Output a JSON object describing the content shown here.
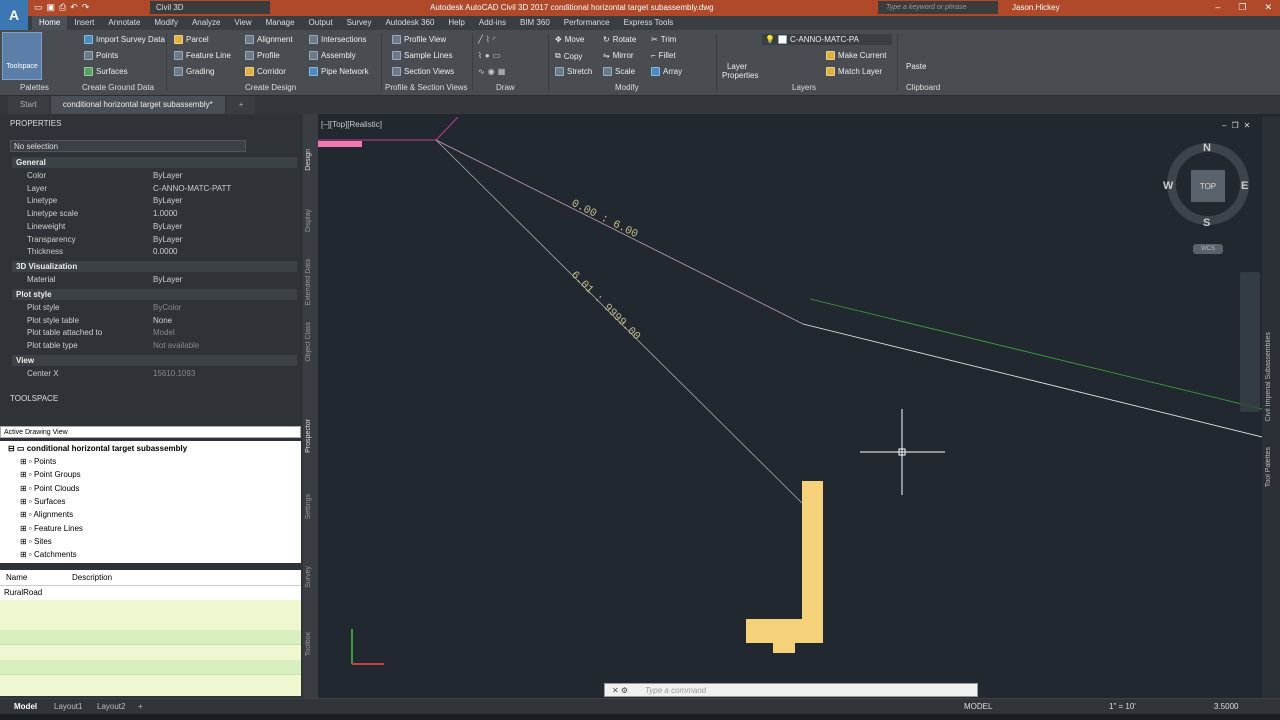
{
  "titlebar": {
    "app_btn": "A",
    "workspace": "Civil 3D",
    "title": "Autodesk AutoCAD Civil 3D 2017    conditional horizontal target subassembly.dwg",
    "search_placeholder": "Type a keyword or phrase",
    "user": "Jason.Hickey"
  },
  "ribbon_tabs": [
    "Home",
    "Insert",
    "Annotate",
    "Modify",
    "Analyze",
    "View",
    "Manage",
    "Output",
    "Survey",
    "Autodesk 360",
    "Help",
    "Add-ins",
    "BIM 360",
    "Performance",
    "Express Tools"
  ],
  "ribbon": {
    "toolspace": "Toolspace",
    "import_survey": "Import Survey Data",
    "points": "Points",
    "surfaces": "Surfaces",
    "parcel": "Parcel",
    "feature_line": "Feature Line",
    "grading": "Grading",
    "alignment": "Alignment",
    "profile": "Profile",
    "corridor": "Corridor",
    "intersections": "Intersections",
    "assembly": "Assembly",
    "pipe_network": "Pipe Network",
    "profile_view": "Profile View",
    "sample_lines": "Sample Lines",
    "section_views": "Section Views",
    "move": "Move",
    "copy": "Copy",
    "stretch": "Stretch",
    "rotate": "Rotate",
    "mirror": "Mirror",
    "scale": "Scale",
    "trim": "Trim",
    "fillet": "Fillet",
    "array": "Array",
    "layer_properties": "Layer Properties",
    "layer_name": "C-ANNO-MATC-PA",
    "make_current": "Make Current",
    "match_layer": "Match Layer",
    "paste": "Paste",
    "panels": {
      "palettes": "Palettes",
      "ground": "Create Ground Data",
      "design": "Create Design",
      "profile_section": "Profile & Section Views",
      "draw": "Draw",
      "modify": "Modify",
      "layers": "Layers",
      "clipboard": "Clipboard"
    }
  },
  "doc_tabs": [
    "Start",
    "conditional horizontal target subassembly*"
  ],
  "properties": {
    "title": "PROPERTIES",
    "selection": "No selection",
    "general": "General",
    "rows_general": [
      {
        "label": "Color",
        "value": "ByLayer"
      },
      {
        "label": "Layer",
        "value": "C-ANNO-MATC-PATT"
      },
      {
        "label": "Linetype",
        "value": "ByLayer"
      },
      {
        "label": "Linetype scale",
        "value": "1.0000"
      },
      {
        "label": "Lineweight",
        "value": "ByLayer"
      },
      {
        "label": "Transparency",
        "value": "ByLayer"
      },
      {
        "label": "Thickness",
        "value": "0.0000"
      }
    ],
    "vis3d": "3D Visualization",
    "material_label": "Material",
    "material_value": "ByLayer",
    "plot_style": "Plot style",
    "rows_plot": [
      {
        "label": "Plot style",
        "value": "ByColor"
      },
      {
        "label": "Plot style table",
        "value": "None"
      },
      {
        "label": "Plot table attached to",
        "value": "Model"
      },
      {
        "label": "Plot table type",
        "value": "Not available"
      }
    ],
    "view": "View",
    "center_x_label": "Center X",
    "center_x_value": "15610.1093",
    "side_tabs": [
      "Design",
      "Display",
      "Extended Data",
      "Object Class"
    ]
  },
  "toolspace": {
    "title": "TOOLSPACE",
    "view_select": "Active Drawing View",
    "root": "conditional horizontal target subassembly",
    "items": [
      "Points",
      "Point Groups",
      "Point Clouds",
      "Surfaces",
      "Alignments",
      "Feature Lines",
      "Sites",
      "Catchments"
    ],
    "side_tabs": [
      "Prospector",
      "Settings",
      "Survey",
      "Toolbox"
    ],
    "col_name": "Name",
    "col_desc": "Description",
    "row_name": "RuralRoad"
  },
  "viewport": {
    "label": "[–][Top][Realistic]",
    "label_a": "0.00 : 6.00",
    "label_b": "6.01 : 9999.00",
    "compass": {
      "n": "N",
      "s": "S",
      "e": "E",
      "w": "W",
      "top": "TOP",
      "wcs": "WCS"
    },
    "right_tabs": [
      "Tool Palettes",
      "Civil Imperial Subassemblies"
    ]
  },
  "command": {
    "placeholder": "Type a command"
  },
  "status": {
    "tabs": [
      "Model",
      "Layout1",
      "Layout2"
    ],
    "model": "MODEL",
    "scale": "1\" = 10'",
    "value": "3.5000"
  },
  "colors": {
    "accent": "#b0492a",
    "magenta": "#c83c96",
    "green": "#3c9a3c",
    "yellow": "#f5d27a"
  }
}
